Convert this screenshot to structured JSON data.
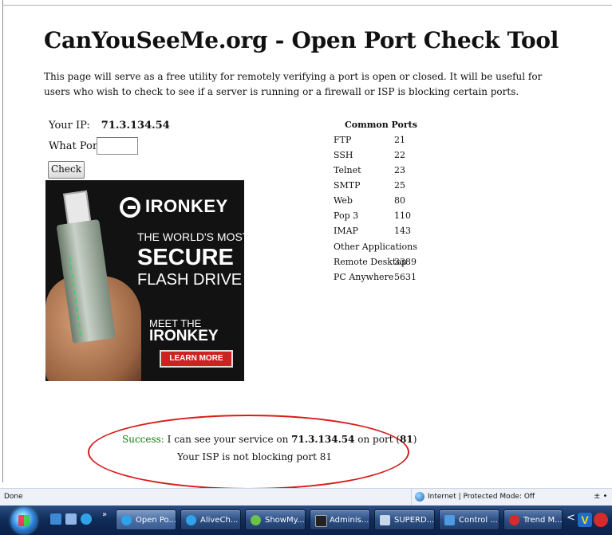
{
  "page": {
    "title": "CanYouSeeMe.org - Open Port Check Tool",
    "intro": "This page will serve as a free utility for remotely verifying a port is open or closed. It will be useful for users who wish to check to see if a server is running or a firewall or ISP is blocking certain ports."
  },
  "form": {
    "ip_label": "Your IP:",
    "ip_value": "71.3.134.54",
    "port_label": "What Port?",
    "port_value": "",
    "check_label": "Check"
  },
  "ad": {
    "brand": "IRONKEY",
    "line1": "THE WORLD'S MOST",
    "line2": "SECURE",
    "line3": "FLASH DRIVE",
    "line4": "MEET THE",
    "line5": "IRONKEY",
    "cta": "LEARN MORE"
  },
  "ports": {
    "title": "Common Ports",
    "list": [
      {
        "name": "FTP",
        "port": "21"
      },
      {
        "name": "SSH",
        "port": "22"
      },
      {
        "name": "Telnet",
        "port": "23"
      },
      {
        "name": "SMTP",
        "port": "25"
      },
      {
        "name": "Web",
        "port": "80"
      },
      {
        "name": "Pop 3",
        "port": "110"
      },
      {
        "name": "IMAP",
        "port": "143"
      }
    ],
    "other_title": "Other Applications",
    "other": [
      {
        "name": "Remote Desktop",
        "port": "3389"
      },
      {
        "name": "PC Anywhere",
        "port": "5631"
      }
    ]
  },
  "result": {
    "success_word": "Success:",
    "line1_text": " I can see your service on ",
    "ip": "71.3.134.54",
    "on_port": " on port (",
    "port": "81",
    "close": ")",
    "line2": "Your ISP is not blocking port 81"
  },
  "statusbar": {
    "done": "Done",
    "zone": "Internet | Protected Mode: Off",
    "zoom": "± •"
  },
  "taskbar": {
    "chevron": "»",
    "buttons": [
      {
        "label": "Open Po...",
        "active": true
      },
      {
        "label": "AliveCh..."
      },
      {
        "label": "ShowMy..."
      },
      {
        "label": "Adminis..."
      },
      {
        "label": "SUPERD..."
      },
      {
        "label": "Control ..."
      },
      {
        "label": "Trend M..."
      }
    ],
    "tray_chevron": "<",
    "tray_v": "V"
  },
  "colors": {
    "success_green": "#0a7a0a",
    "ellipse_red": "#d81b1b",
    "taskbar_blue": "#1b3a6b"
  }
}
